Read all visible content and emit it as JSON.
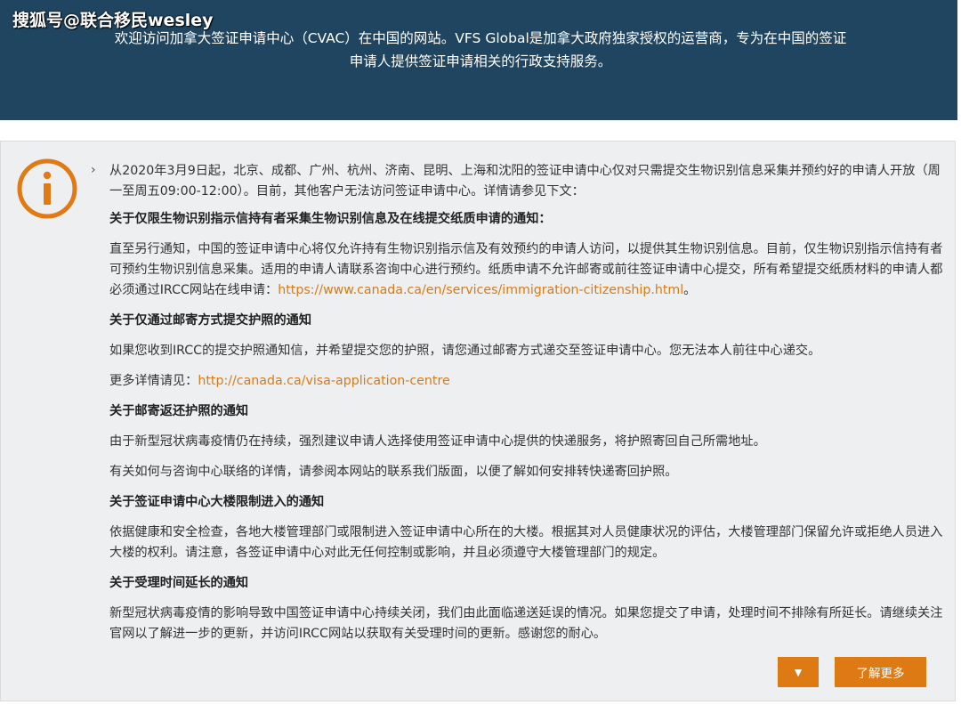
{
  "watermark": {
    "text": "搜狐号@联合移民wesley"
  },
  "banner": {
    "line1": "欢迎访问加拿大签证申请中心（CVAC）在中国的网站。VFS Global是加拿大政府独家授权的运营商，专为在中国的签证",
    "line2": "申请人提供签证申请相关的行政支持服务。"
  },
  "notice": {
    "intro": "从2020年3月9日起，北京、成都、广州、杭州、济南、昆明、上海和沈阳的签证申请中心仅对只需提交生物识别信息采集并预约好的申请人开放（周一至周五09:00-12:00）。目前，其他客户无法访问签证申请中心。详情请参见下文：",
    "s1_title": "关于仅限生物识别指示信持有者采集生物识别信息及在线提交纸质申请的通知：",
    "s1_body": "直至另行通知，中国的签证申请中心将仅允许持有生物识别指示信及有效预约的申请人访问，以提供其生物识别信息。目前，仅生物识别指示信持有者可预约生物识别信息采集。适用的申请人请联系咨询中心进行预约。纸质申请不允许邮寄或前往签证申请中心提交，所有希望提交纸质材料的申请人都必须通过IRCC网站在线申请：",
    "s1_link": "https://www.canada.ca/en/services/immigration-citizenship.html",
    "s1_end": "。",
    "s2_title": "关于仅通过邮寄方式提交护照的通知",
    "s2_body": "如果您收到IRCC的提交护照通知信，并希望提交您的护照，请您通过邮寄方式递交至签证申请中心。您无法本人前往中心递交。",
    "s2_more_label": "更多详情请见：",
    "s2_link": "http://canada.ca/visa-application-centre",
    "s3_title": "关于邮寄返还护照的通知",
    "s3_body1": "由于新型冠状病毒疫情仍在持续，强烈建议申请人选择使用签证申请中心提供的快递服务，将护照寄回自己所需地址。",
    "s3_body2": "有关如何与咨询中心联络的详情，请参阅本网站的联系我们版面，以便了解如何安排转快递寄回护照。",
    "s4_title": "关于签证申请中心大楼限制进入的通知",
    "s4_body": "依据健康和安全检查，各地大楼管理部门或限制进入签证申请中心所在的大楼。根据其对人员健康状况的评估，大楼管理部门保留允许或拒绝人员进入大楼的权利。请注意，各签证申请中心对此无任何控制或影响，并且必须遵守大楼管理部门的规定。",
    "s5_title": "关于受理时间延长的通知",
    "s5_body": "新型冠状病毒疫情的影响导致中国签证申请中心持续关闭，我们由此面临递送延误的情况。如果您提交了申请，处理时间不排除有所延长。请继续关注官网以了解进一步的更新，并访问IRCC网站以获取有关受理时间的更新。感谢您的耐心。",
    "toggle_glyph": "▼",
    "more_button": "了解更多"
  },
  "icons": {
    "info": "info-icon",
    "chevron": "chevron-right-icon"
  },
  "colors": {
    "banner_bg": "#1f4560",
    "accent": "#dd7a14",
    "link": "#d97a16",
    "notice_bg": "#edeff0"
  }
}
